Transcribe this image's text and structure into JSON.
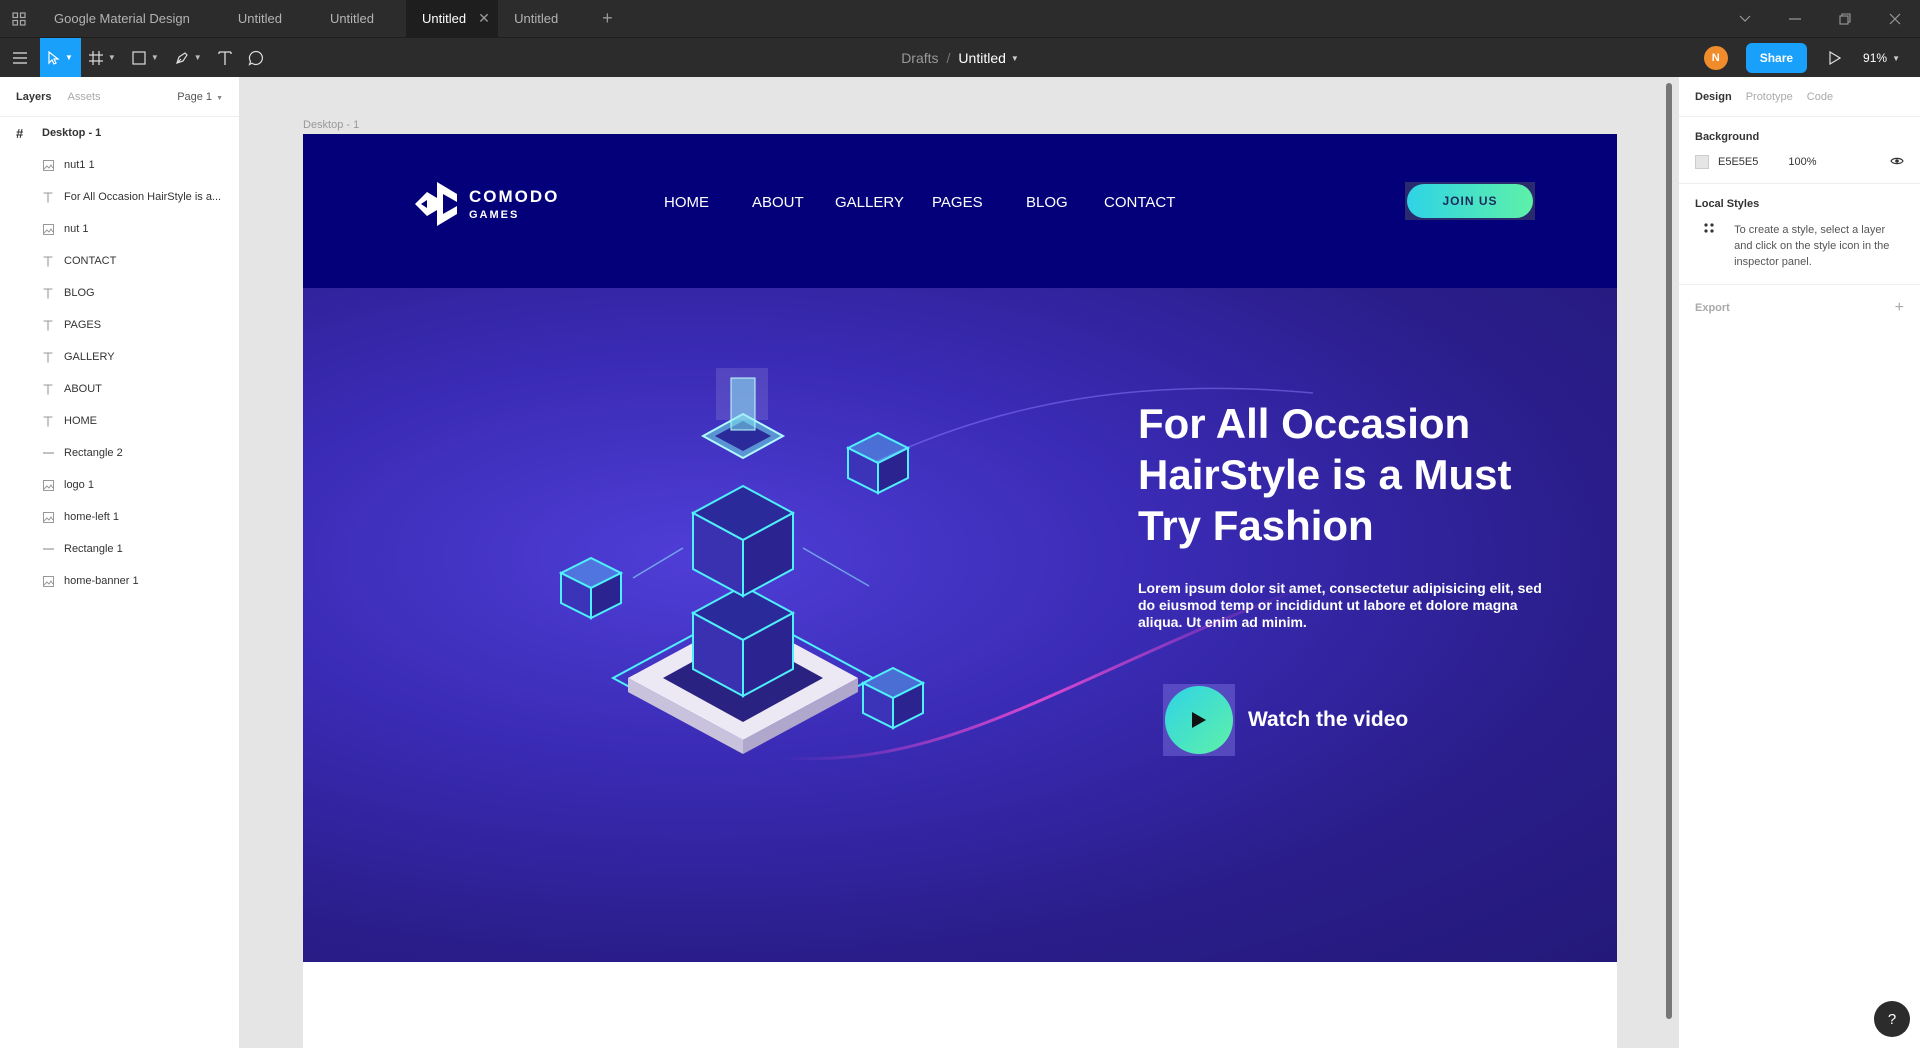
{
  "tabs": [
    {
      "label": "Google Material Design",
      "active": false
    },
    {
      "label": "Untitled",
      "active": false
    },
    {
      "label": "Untitled",
      "active": false
    },
    {
      "label": "Untitled",
      "active": true
    },
    {
      "label": "Untitled",
      "active": false
    }
  ],
  "toolbar": {
    "breadcrumb_parent": "Drafts",
    "breadcrumb_separator": "/",
    "file_name": "Untitled",
    "avatar_initial": "N",
    "share_label": "Share",
    "zoom": "91%"
  },
  "left_panel": {
    "tabs": [
      "Layers",
      "Assets"
    ],
    "page": "Page 1",
    "frame_layer": "Desktop - 1",
    "layers": [
      {
        "name": "nut1 1",
        "type": "image"
      },
      {
        "name": "For All Occasion HairStyle is a...",
        "type": "text"
      },
      {
        "name": "nut 1",
        "type": "image"
      },
      {
        "name": "CONTACT",
        "type": "text"
      },
      {
        "name": "BLOG",
        "type": "text"
      },
      {
        "name": "PAGES",
        "type": "text"
      },
      {
        "name": "GALLERY",
        "type": "text"
      },
      {
        "name": "ABOUT",
        "type": "text"
      },
      {
        "name": "HOME",
        "type": "text"
      },
      {
        "name": "Rectangle 2",
        "type": "line"
      },
      {
        "name": "logo 1",
        "type": "image"
      },
      {
        "name": "home-left 1",
        "type": "image"
      },
      {
        "name": "Rectangle 1",
        "type": "line"
      },
      {
        "name": "home-banner 1",
        "type": "image"
      }
    ]
  },
  "canvas": {
    "frame_label": "Desktop - 1",
    "site": {
      "brand_name": "COMODO",
      "brand_sub": "GAMES",
      "nav": [
        "HOME",
        "ABOUT",
        "GALLERY",
        "PAGES",
        "BLOG",
        "CONTACT"
      ],
      "join_label": "JOIN US",
      "hero_title": "For All Occasion HairStyle is a Must Try Fashion",
      "hero_desc": "Lorem ipsum dolor sit amet, consectetur adipisicing elit, sed do eiusmod temp or incididunt ut labore et dolore magna aliqua. Ut enim ad minim.",
      "watch_label": "Watch the video"
    }
  },
  "right_panel": {
    "tabs": [
      "Design",
      "Prototype",
      "Code"
    ],
    "background_title": "Background",
    "background_hex": "E5E5E5",
    "background_opacity": "100%",
    "local_styles_title": "Local Styles",
    "local_styles_hint": "To create a style, select a layer and click on the style icon in the inspector panel.",
    "export_title": "Export"
  },
  "help_label": "?",
  "colors": {
    "accent": "#18a0fb",
    "header_bg": "#04007a",
    "hero_bg": "#3a2bb5",
    "button_gradient_start": "#2fd3e6",
    "button_gradient_end": "#5ef1a8",
    "avatar": "#f08c2b",
    "canvas_bg": "#e5e5e5"
  }
}
